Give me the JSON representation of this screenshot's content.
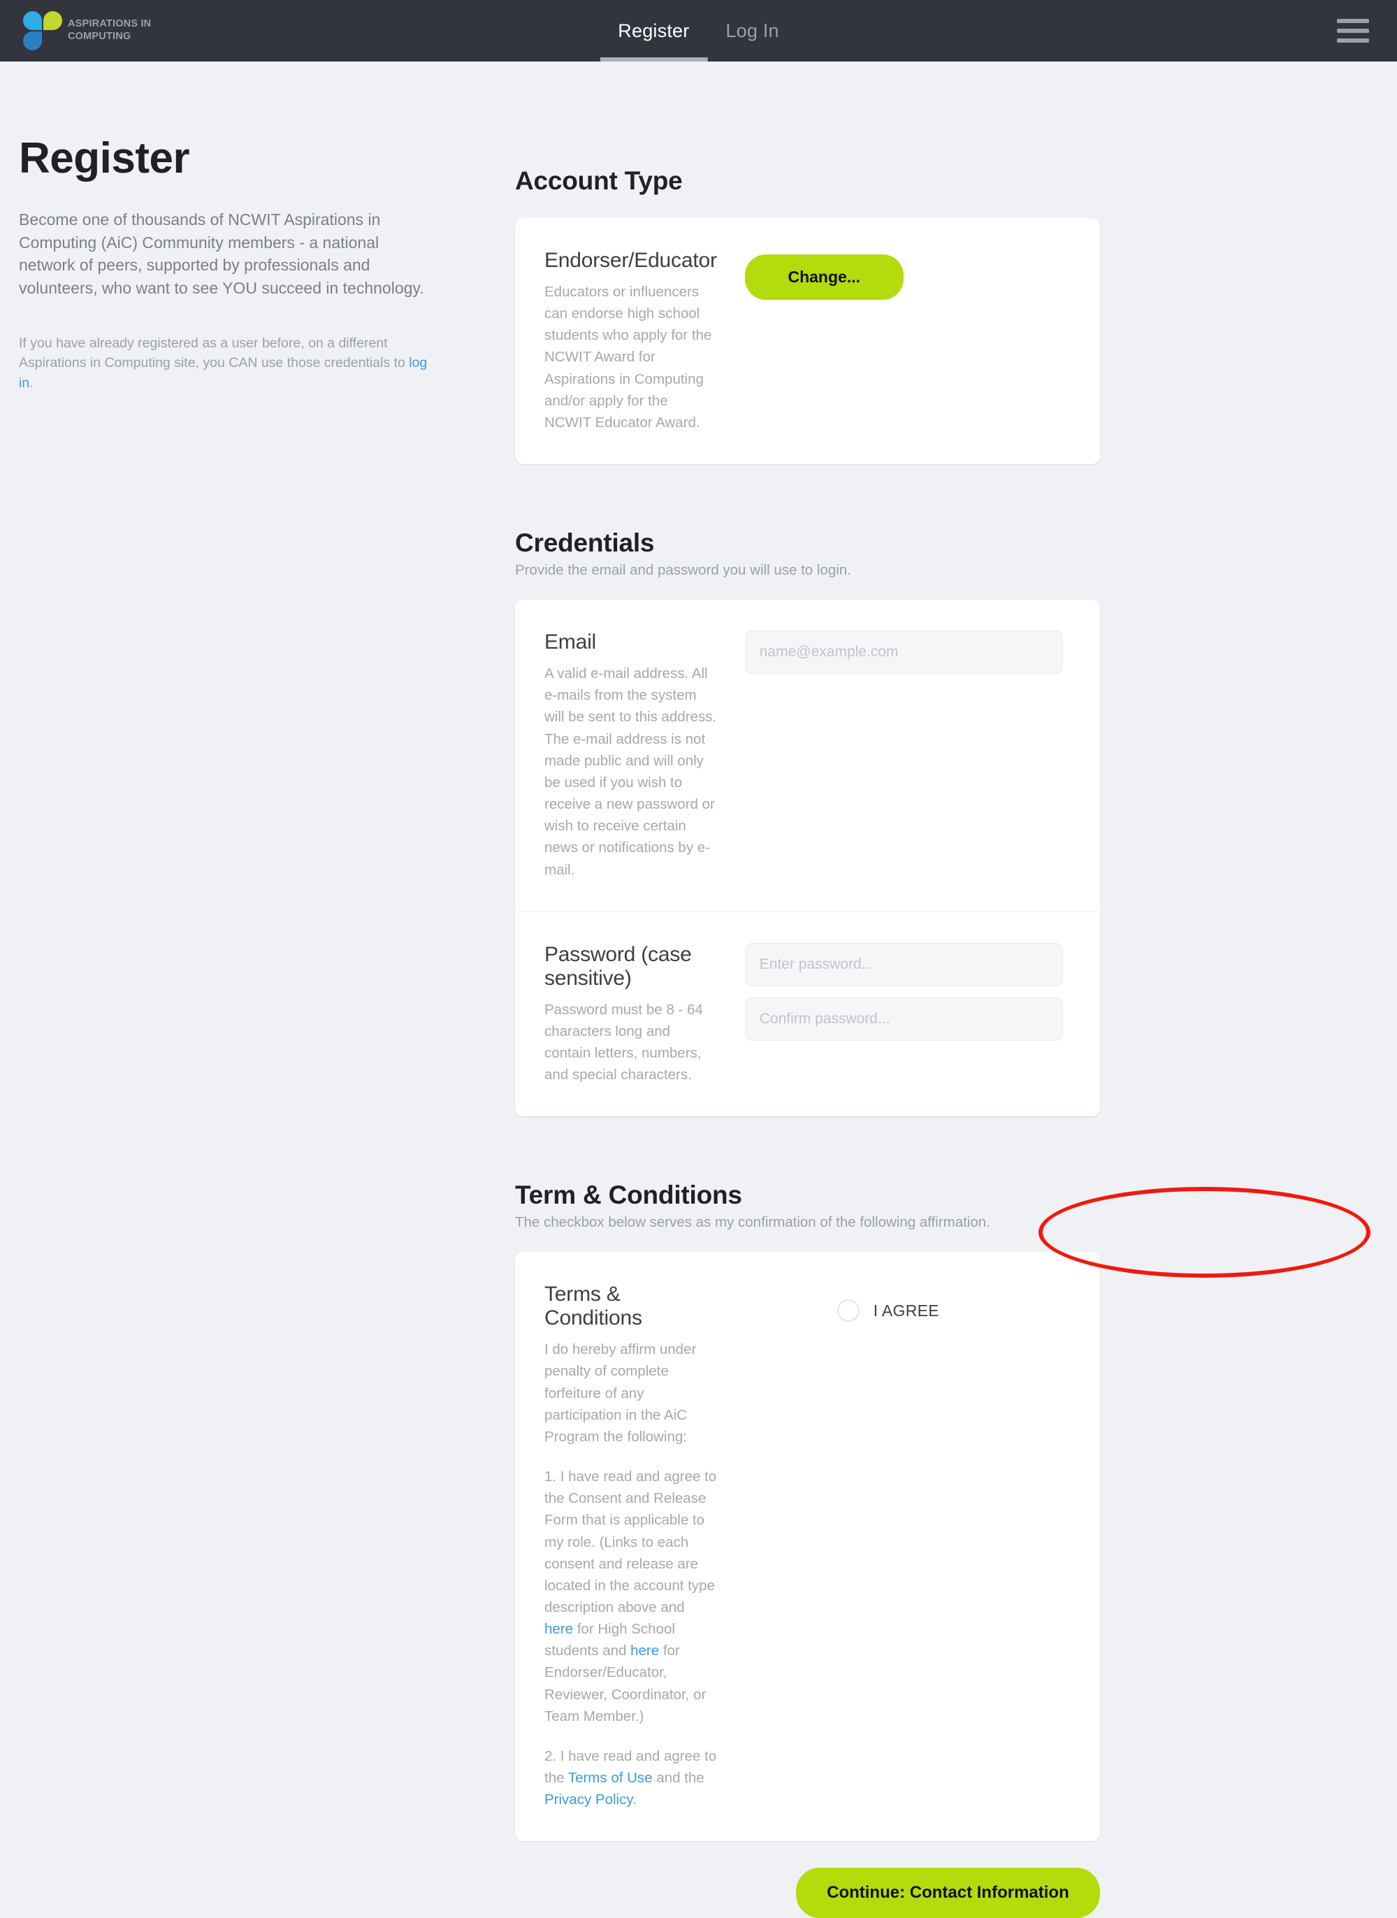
{
  "navbar": {
    "brand_name": "ASPIRATIONS IN\nCOMPUTING",
    "links": [
      {
        "label": "Register",
        "active": true
      },
      {
        "label": "Log In",
        "active": false
      }
    ],
    "menu_icon": "hamburger-icon",
    "logo_colors": {
      "cyan": "#2fade4",
      "lime": "#c3d82e",
      "blue": "#2a7fc3"
    },
    "background": "#32353e"
  },
  "intro": {
    "title": "Register",
    "lead": "Become one of thousands of NCWIT Aspirations in Computing (AiC) Community members - a national network of peers, supported by professionals and volunteers, who want to see YOU succeed in technology.",
    "note_before_link": "If you have already registered as a user before, on a different Aspirations in Computing site, you CAN use those credentials to ",
    "note_link": "log in",
    "note_after_link": "."
  },
  "account_type": {
    "section_title": "Account Type",
    "name": "Endorser/Educator",
    "description": "Educators or influencers can endorse high school students who apply for the NCWIT Award for Aspirations in Computing and/or apply for the NCWIT Educator Award.",
    "change_label": "Change..."
  },
  "credentials": {
    "section_title": "Credentials",
    "section_sub": "Provide the email and password you will use to login.",
    "email": {
      "title": "Email",
      "description": "A valid e-mail address. All e-mails from the system will be sent to this address. The e-mail address is not made public and will only be used if you wish to receive a new password or wish to receive certain news or notifications by e-mail.",
      "placeholder": "name@example.com",
      "value": ""
    },
    "password": {
      "title": "Password (case sensitive)",
      "description": "Password must be 8 - 64 characters long and contain letters, numbers, and special characters.",
      "placeholder": "Enter password...",
      "confirm_placeholder": "Confirm password...",
      "value": "",
      "confirm_value": ""
    }
  },
  "terms": {
    "section_title": "Term & Conditions",
    "section_sub": "The checkbox below serves as my confirmation of the following affirmation.",
    "card_title": "Terms & Conditions",
    "affirmation": "I do hereby affirm under penalty of complete forfeiture of any participation in the AiC Program the following:",
    "item1_part1": "1. I have read and agree to the Consent and Release Form that is applicable to my role. (Links to each consent and release are located in the account type description above and ",
    "item1_link1": "here",
    "item1_part2": " for High School students and ",
    "item1_link2": "here",
    "item1_part3": " for Endorser/Educator, Reviewer, Coordinator, or Team Member.)",
    "item2_part1": "2. I have read and agree to the ",
    "item2_link1": "Terms of Use",
    "item2_part2": " and the ",
    "item2_link2": "Privacy Policy",
    "item2_part3": ".",
    "agree_label": "I AGREE",
    "agree_checked": false
  },
  "footer": {
    "continue_label": "Continue: Contact Information"
  },
  "annotation": {
    "shape": "ellipse",
    "color": "#f01a0d",
    "target": "continue-button"
  }
}
